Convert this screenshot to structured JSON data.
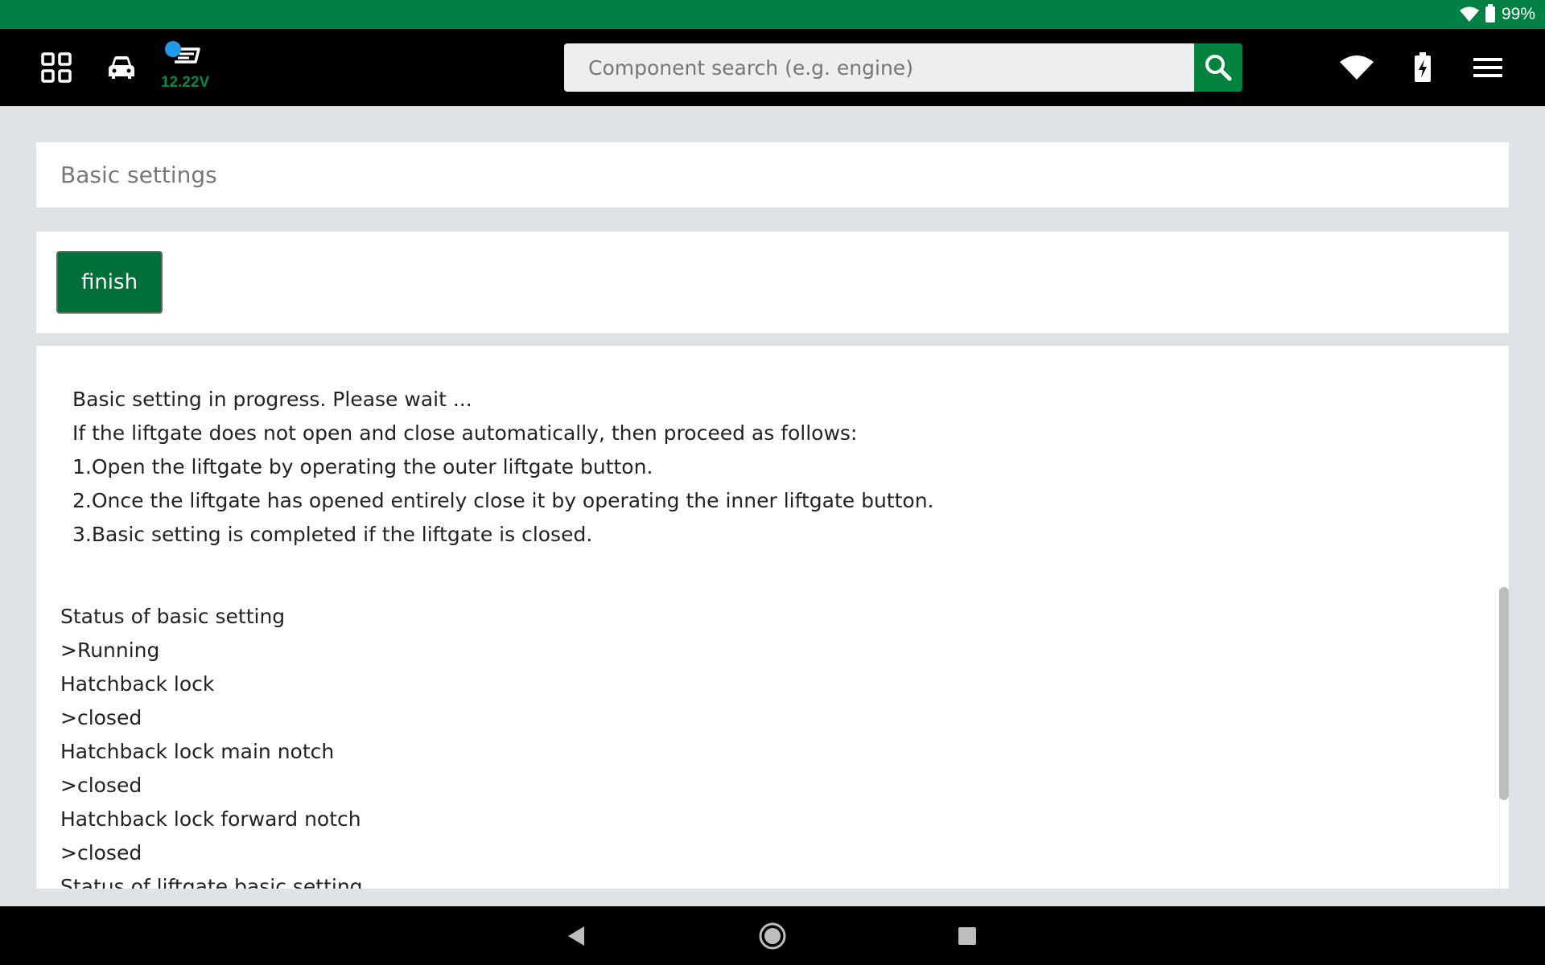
{
  "status_bar": {
    "battery_percent": "99%"
  },
  "toolbar": {
    "voltage": "12.22V",
    "search": {
      "placeholder": "Component search (e.g. engine)",
      "value": ""
    }
  },
  "header": {
    "title": "Basic settings"
  },
  "actions": {
    "finish_label": "finish"
  },
  "instructions": [
    "Basic setting in progress. Please wait ...",
    "If the liftgate does not open and close automatically, then proceed as follows:",
    "1.Open the liftgate by operating the outer liftgate button.",
    "2.Once the liftgate has opened entirely close it by operating the inner liftgate button.",
    "3.Basic setting is completed if the liftgate is closed."
  ],
  "status_lines": [
    "Status of basic setting",
    ">Running",
    "Hatchback lock",
    ">closed",
    "Hatchback lock main notch",
    ">closed",
    "Hatchback lock forward notch",
    ">closed",
    "Status of liftgate basic setting"
  ],
  "colors": {
    "status_bar": "#008143",
    "accent": "#00843d",
    "voltage_text": "#008b45",
    "dot": "#1e9be9"
  },
  "icons": {
    "grid": "grid-icon",
    "car": "car-icon",
    "connector": "vci-connector-icon",
    "search": "search-icon",
    "wifi": "wifi-icon",
    "battery": "battery-charging-icon",
    "menu": "hamburger-menu-icon",
    "back": "back-triangle-icon",
    "home": "home-circle-icon",
    "recents": "recents-square-icon"
  }
}
